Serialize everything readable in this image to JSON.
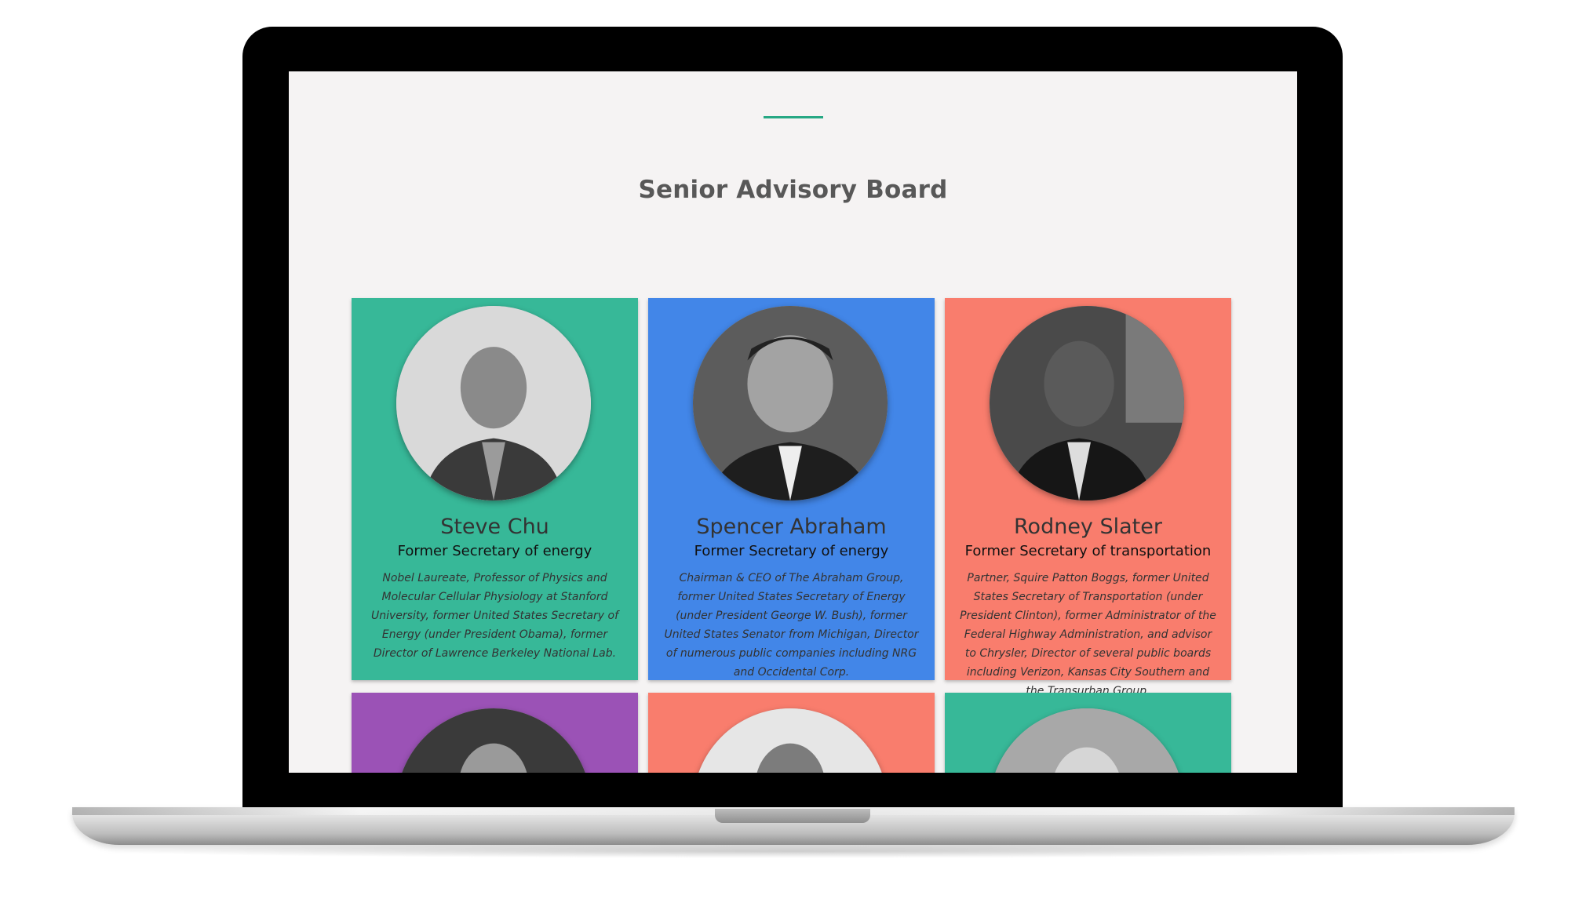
{
  "section": {
    "title": "Senior Advisory Board"
  },
  "colors": {
    "accent": "#27a884",
    "green": "#37b898",
    "blue": "#4286e8",
    "coral": "#f97d6d",
    "purple": "#9b52b6"
  },
  "members": [
    {
      "name": "Steve Chu",
      "role": "Former Secretary of energy",
      "bio": "Nobel Laureate, Professor of Physics and Molecular Cellular Physiology at Stanford University, former United States Secretary of Energy (under President Obama), former Director of Lawrence Berkeley National Lab.",
      "color": "#37b898",
      "photo": "portrait-photo"
    },
    {
      "name": "Spencer Abraham",
      "role": "Former Secretary of energy",
      "bio": "Chairman & CEO of The Abraham Group, former United States Secretary of Energy (under President George W. Bush), former United States Senator from Michigan, Director of numerous public companies including NRG and Occidental Corp.",
      "color": "#4286e8",
      "photo": "portrait-photo"
    },
    {
      "name": "Rodney Slater",
      "role": "Former Secretary of transportation",
      "bio": "Partner, Squire Patton Boggs, former United States Secretary of Transportation (under President Clinton), former Administrator of the Federal Highway Administration, and advisor to Chrysler, Director of several public boards including Verizon, Kansas City Southern and the Transurban Group.",
      "color": "#f97d6d",
      "photo": "portrait-photo"
    }
  ],
  "next_row": [
    {
      "color": "#9b52b6",
      "photo": "portrait-photo"
    },
    {
      "color": "#f97d6d",
      "photo": "portrait-photo"
    },
    {
      "color": "#37b898",
      "photo": "portrait-photo"
    }
  ]
}
